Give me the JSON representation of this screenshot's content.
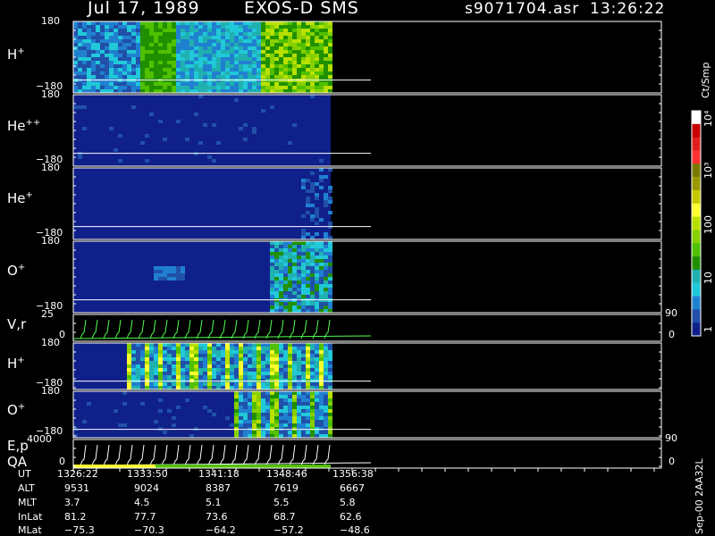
{
  "header": {
    "date": "Jul 17, 1989",
    "instrument": "EXOS-D SMS",
    "filename": "s9071704.asr",
    "time": "13:26:22"
  },
  "colorbar": {
    "unit_label": "Ct/Smp",
    "tick_labels": [
      "10⁴",
      "10³",
      "100",
      "10",
      "1"
    ],
    "colors": [
      "#ffffff",
      "#c80000",
      "#e02020",
      "#ff3030",
      "#7a7a00",
      "#9a9a00",
      "#c8c800",
      "#ffff30",
      "#b8e000",
      "#88d000",
      "#50c000",
      "#209000",
      "#20b0b0",
      "#20c8d8",
      "#2080d0",
      "#2050a8",
      "#10208a"
    ]
  },
  "panels": [
    {
      "id": "h-plus",
      "label_base": "H",
      "label_sup": "+",
      "y_top": "180",
      "y_bottom": "−180"
    },
    {
      "id": "he-plusplus",
      "label_base": "He",
      "label_sup": "++",
      "y_top": "180",
      "y_bottom": "−180"
    },
    {
      "id": "he-plus",
      "label_base": "He",
      "label_sup": "+",
      "y_top": "180",
      "y_bottom": "−180"
    },
    {
      "id": "o-plus",
      "label_base": "O",
      "label_sup": "+",
      "y_top": "180",
      "y_bottom": "−180"
    },
    {
      "id": "vr",
      "label_base": "V,r",
      "label_sup": "",
      "y_top": "25",
      "y_bottom": "0",
      "right_top": "90",
      "right_bottom": "0"
    },
    {
      "id": "h-plus-2",
      "label_base": "H",
      "label_sup": "+",
      "y_top": "180",
      "y_bottom": "−180"
    },
    {
      "id": "o-plus-2",
      "label_base": "O",
      "label_sup": "+",
      "y_top": "180",
      "y_bottom": "−180"
    },
    {
      "id": "ep-qa",
      "label_base": "E,p",
      "label_line2": "QA",
      "label_sup": "",
      "y_top": "4000",
      "y_bottom": "0",
      "right_top": "90",
      "right_bottom": "0"
    }
  ],
  "table": {
    "row_labels": [
      "UT",
      "ALT",
      "MLT",
      "InLat",
      "MLat"
    ],
    "columns": [
      [
        "1326:22",
        "9531",
        "3.7",
        "81.2",
        "−75.3"
      ],
      [
        "1333:50",
        "9024",
        "4.5",
        "77.7",
        "−70.3"
      ],
      [
        "1341:18",
        "8387",
        "5.1",
        "73.6",
        "−64.2"
      ],
      [
        "1348:46",
        "7619",
        "5.5",
        "68.7",
        "−57.2"
      ],
      [
        "1356:38",
        "6667",
        "5.8",
        "62.6",
        "−48.6"
      ]
    ]
  },
  "footer_vertical": "Sep-00 2AA32L",
  "chart_data": {
    "type": "heatmap",
    "title": "Jul 17, 1989   EXOS-D SMS",
    "x_ticks": [
      "1326:22",
      "1333:50",
      "1341:18",
      "1348:46",
      "1356:38"
    ],
    "colorbar_label": "Ct/Smp",
    "colorbar_ticks": [
      "1",
      "10",
      "100",
      "10³",
      "10⁴"
    ],
    "panels": [
      "H+",
      "He++",
      "He+",
      "O+",
      "V,r",
      "H+",
      "O+",
      "E,p QA"
    ],
    "y_range_spectrogram": [
      -180,
      180
    ]
  }
}
